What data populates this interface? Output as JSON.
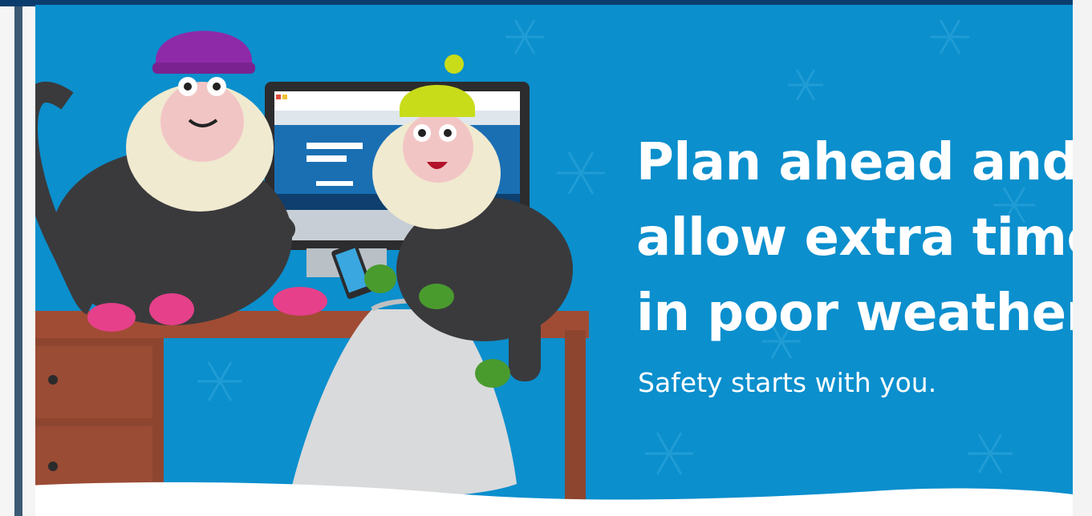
{
  "banner": {
    "headline_lines": [
      "Plan ahead and",
      "allow extra time",
      "in poor weather."
    ],
    "tagline": "Safety starts with you."
  },
  "colors": {
    "background_blue": "#0b8fcd",
    "top_bar": "#0a3d6e",
    "desk": "#9a4a33",
    "monkey_body": "#3a3a3c",
    "hat_purple": "#8e2aa8",
    "hat_yellow": "#c8dc1a",
    "gloves_pink": "#e6408a",
    "gloves_green": "#4a9b2e",
    "snow": "#ffffff"
  },
  "icons": [
    "snowflake-icon",
    "smartphone-icon",
    "computer-monitor-icon"
  ]
}
